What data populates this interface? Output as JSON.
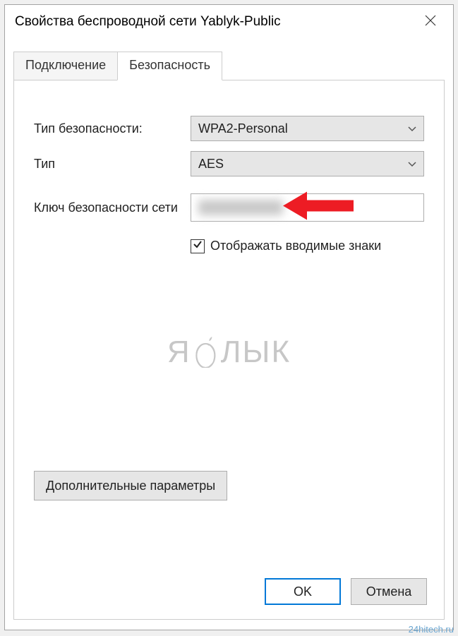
{
  "window": {
    "title": "Свойства беспроводной сети Yablyk-Public"
  },
  "tabs": {
    "connection": "Подключение",
    "security": "Безопасность"
  },
  "form": {
    "security_type_label": "Тип безопасности:",
    "security_type_value": "WPA2-Personal",
    "encryption_type_label": "Тип",
    "encryption_type_value": "AES",
    "key_label": "Ключ безопасности сети",
    "show_chars_label": "Отображать вводимые знаки",
    "show_chars_checked": true
  },
  "watermark": "ЯБЛЫК",
  "buttons": {
    "advanced": "Дополнительные параметры",
    "ok": "OK",
    "cancel": "Отмена"
  },
  "site_watermark": "24hitech.ru"
}
